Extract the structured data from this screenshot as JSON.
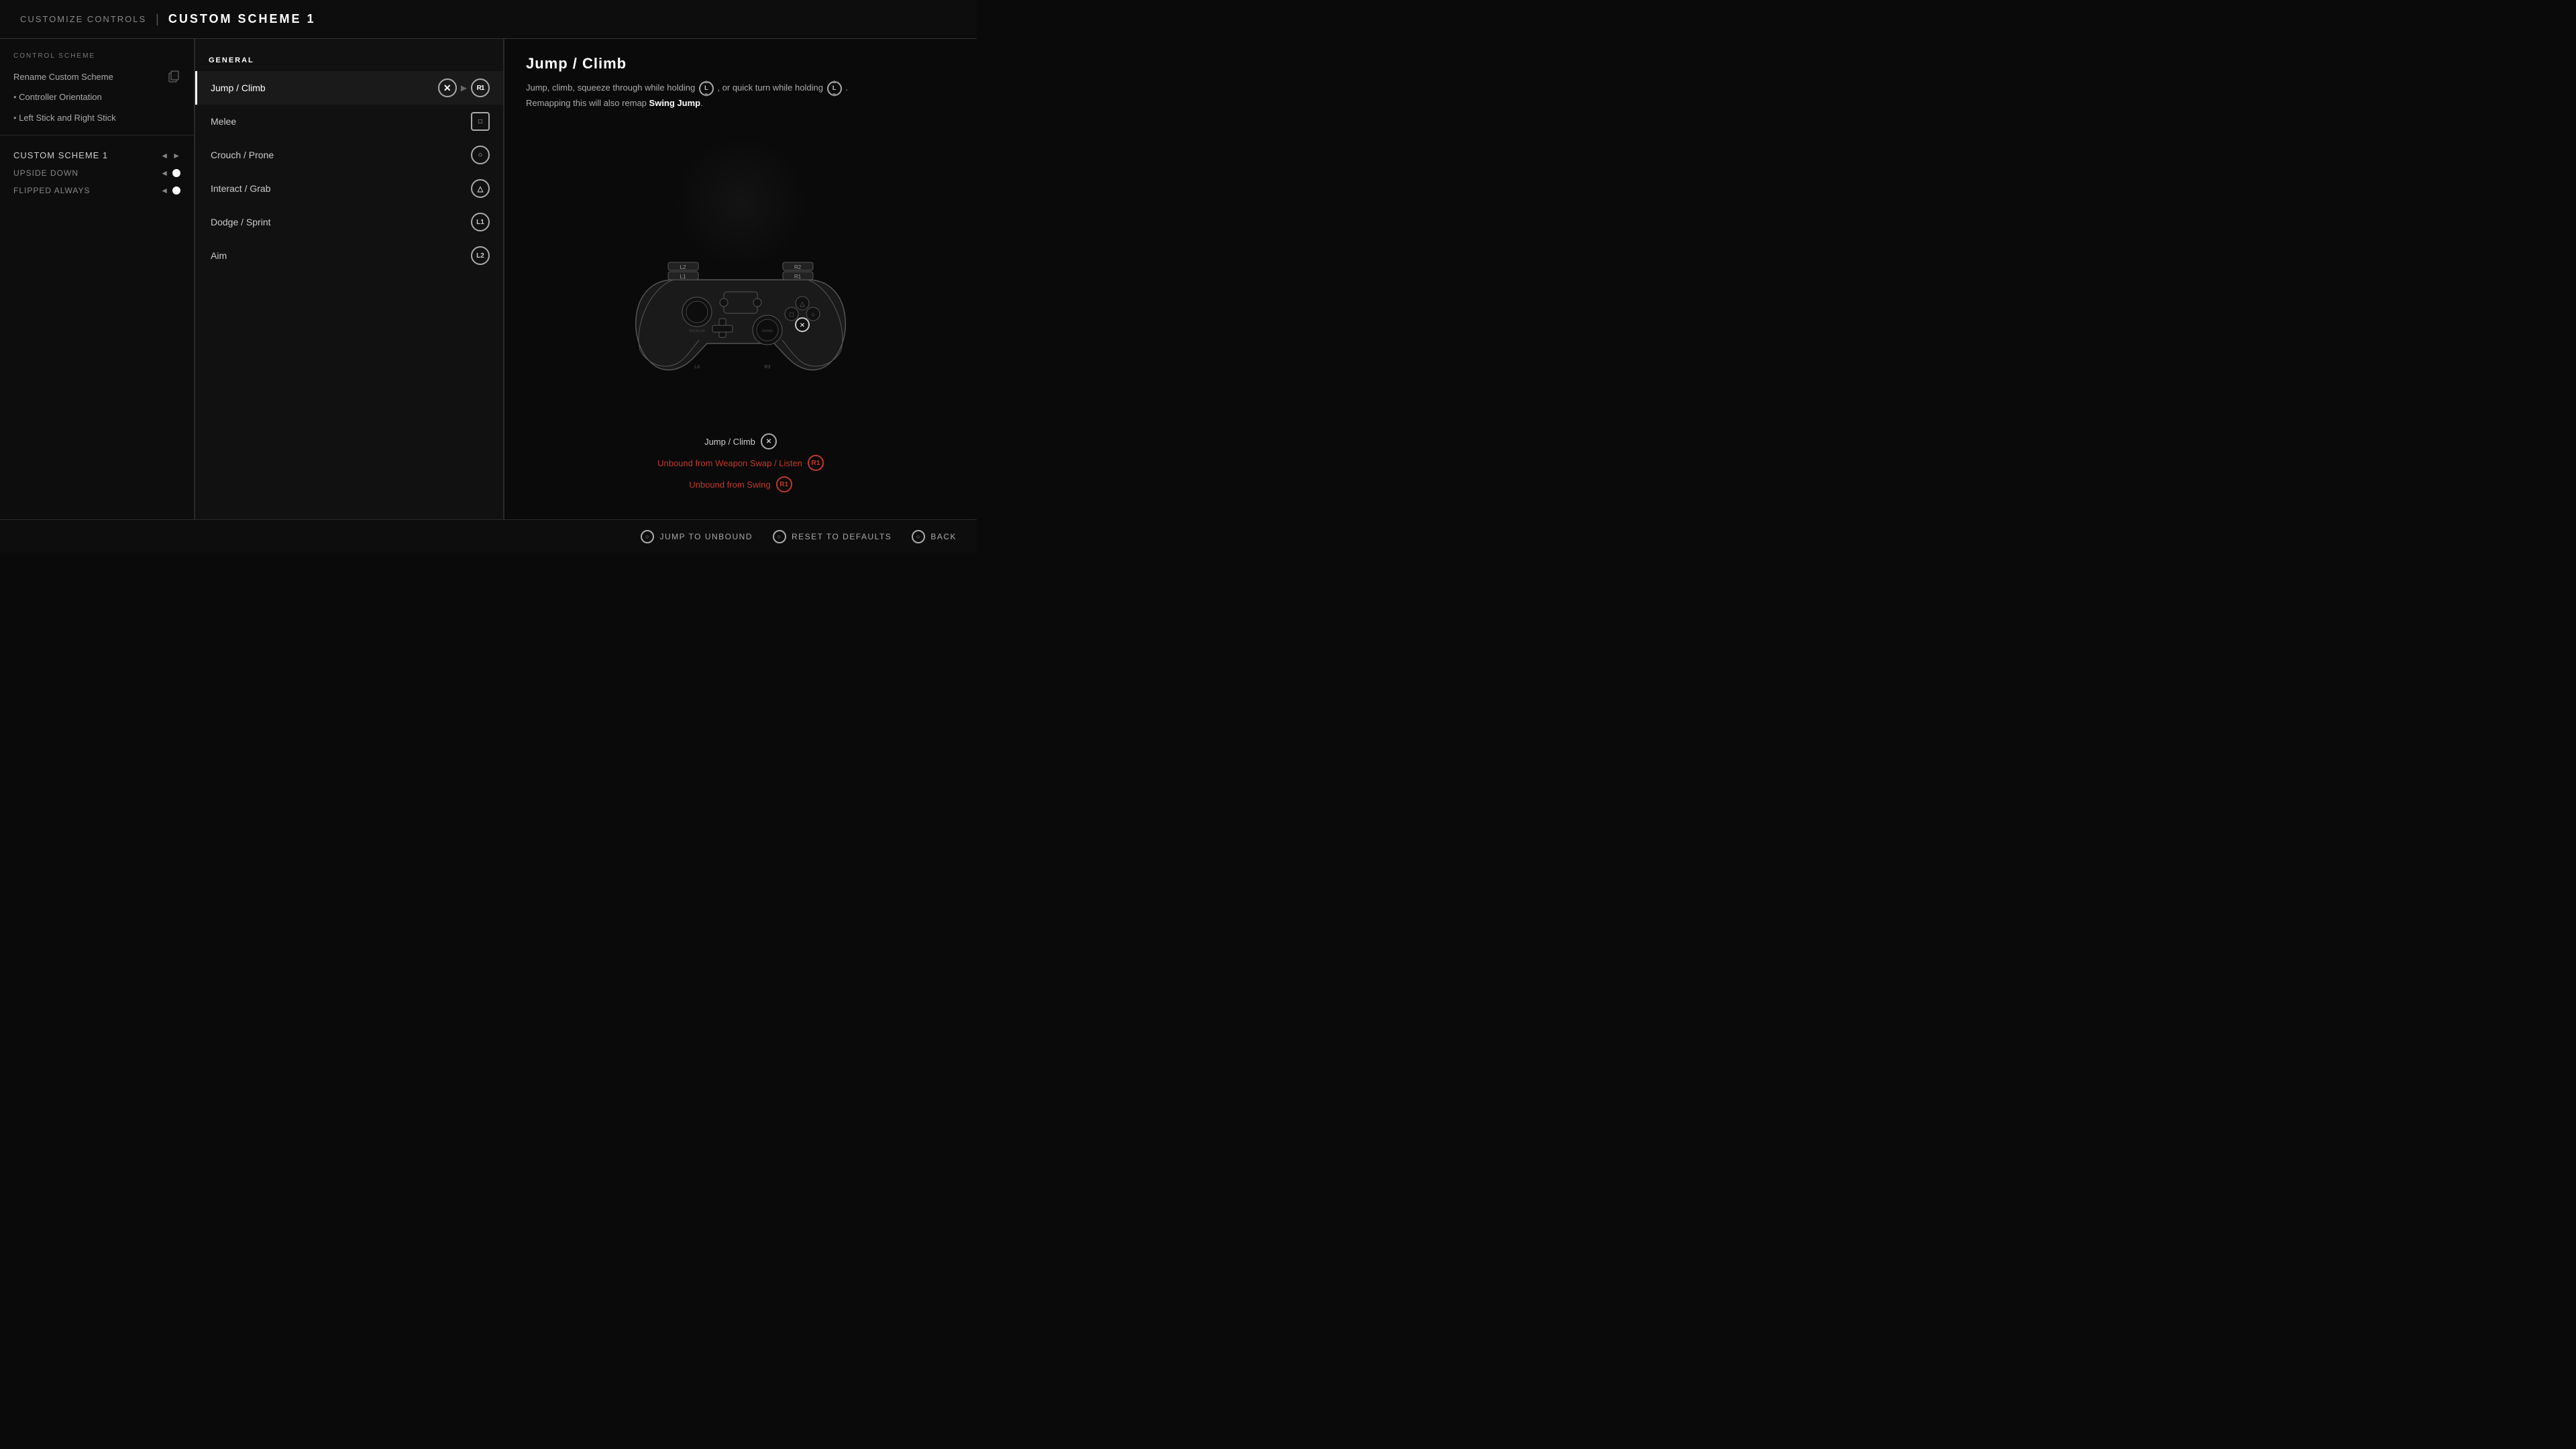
{
  "header": {
    "breadcrumb": "CUSTOMIZE CONTROLS",
    "divider": "|",
    "title": "CUSTOM SCHEME 1"
  },
  "left_panel": {
    "section_label": "CONTROL SCHEME",
    "rename_label": "Rename Custom Scheme",
    "menu_items": [
      {
        "label": "Controller Orientation",
        "bullet": true
      },
      {
        "label": "Left Stick and Right Stick",
        "bullet": true
      }
    ],
    "scheme_name": "CUSTOM SCHEME 1",
    "upside_down_label": "UPSIDE DOWN",
    "flipped_always_label": "FLIPPED ALWAYS"
  },
  "middle_panel": {
    "general_label": "GENERAL",
    "actions": [
      {
        "label": "Jump / Climb",
        "button": "×",
        "button2": "R1",
        "active": true
      },
      {
        "label": "Melee",
        "button": "□",
        "active": false
      },
      {
        "label": "Crouch / Prone",
        "button": "○",
        "active": false
      },
      {
        "label": "Interact / Grab",
        "button": "△",
        "active": false
      },
      {
        "label": "Dodge / Sprint",
        "button": "L1",
        "active": false
      },
      {
        "label": "Aim",
        "button": "L2",
        "active": false
      }
    ]
  },
  "right_panel": {
    "action_title": "Jump / Climb",
    "description_parts": [
      "Jump, climb, squeeze through ",
      "while holding",
      " L, or quick turn while holding L. Remapping this will also remap ",
      "Swing Jump",
      "."
    ],
    "controller_info": [
      {
        "label": "Jump / Climb",
        "badge": "×",
        "unbound": false
      },
      {
        "label": "Unbound from Weapon Swap / Listen",
        "badge": "R1",
        "unbound": true
      },
      {
        "label": "Unbound from Swing",
        "badge": "R1",
        "unbound": true
      }
    ],
    "scheme_sublabel": "CUSTOM SCHEME"
  },
  "bottom_bar": {
    "jump_to_unbound": "JUMP TO UNBOUND",
    "reset_to_defaults": "RESET TO DEFAULTS",
    "back": "BACK",
    "icon_jump": "○",
    "icon_reset": "○",
    "icon_back": "○"
  }
}
